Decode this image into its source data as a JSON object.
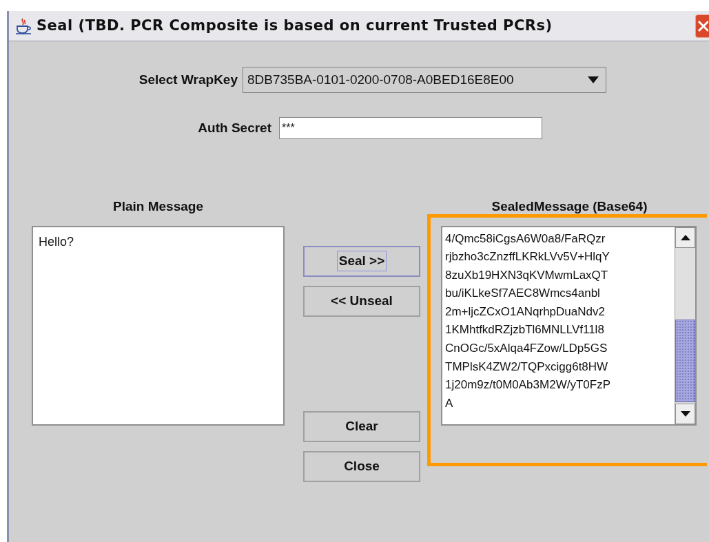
{
  "window": {
    "title": "Seal (TBD. PCR Composite is based on current Trusted PCRs)"
  },
  "wrap_key": {
    "label": "Select WrapKey",
    "value": "8DB735BA-0101-0200-0708-A0BED16E8E00"
  },
  "auth_secret": {
    "label": "Auth Secret",
    "value": "***"
  },
  "plain_message": {
    "label": "Plain Message",
    "text": "Hello?"
  },
  "sealed_message": {
    "label": "SealedMessage (Base64)",
    "highlighted": true,
    "lines": [
      "4/Qmc58iCgsA6W0a8/FaRQzr",
      "rjbzho3cZnzffLKRkLVv5V+HlqY",
      "8zuXb19HXN3qKVMwmLaxQT",
      "bu/iKLkeSf7AEC8Wmcs4anbl",
      "2m+ljcZCxO1ANqrhpDuaNdv2",
      "1KMhtfkdRZjzbTl6MNLLVf11l8",
      "CnOGc/5xAlqa4FZow/LDp5GS",
      "TMPlsK4ZW2/TQPxcigg6t8HW",
      "1j20m9z/t0M0Ab3M2W/yT0FzP",
      "A"
    ]
  },
  "buttons": [
    {
      "label": "Seal >>",
      "focused": true
    },
    {
      "label": "<< Unseal",
      "focused": false
    },
    {
      "label": "Clear",
      "focused": false
    },
    {
      "label": "Close",
      "focused": false
    }
  ]
}
